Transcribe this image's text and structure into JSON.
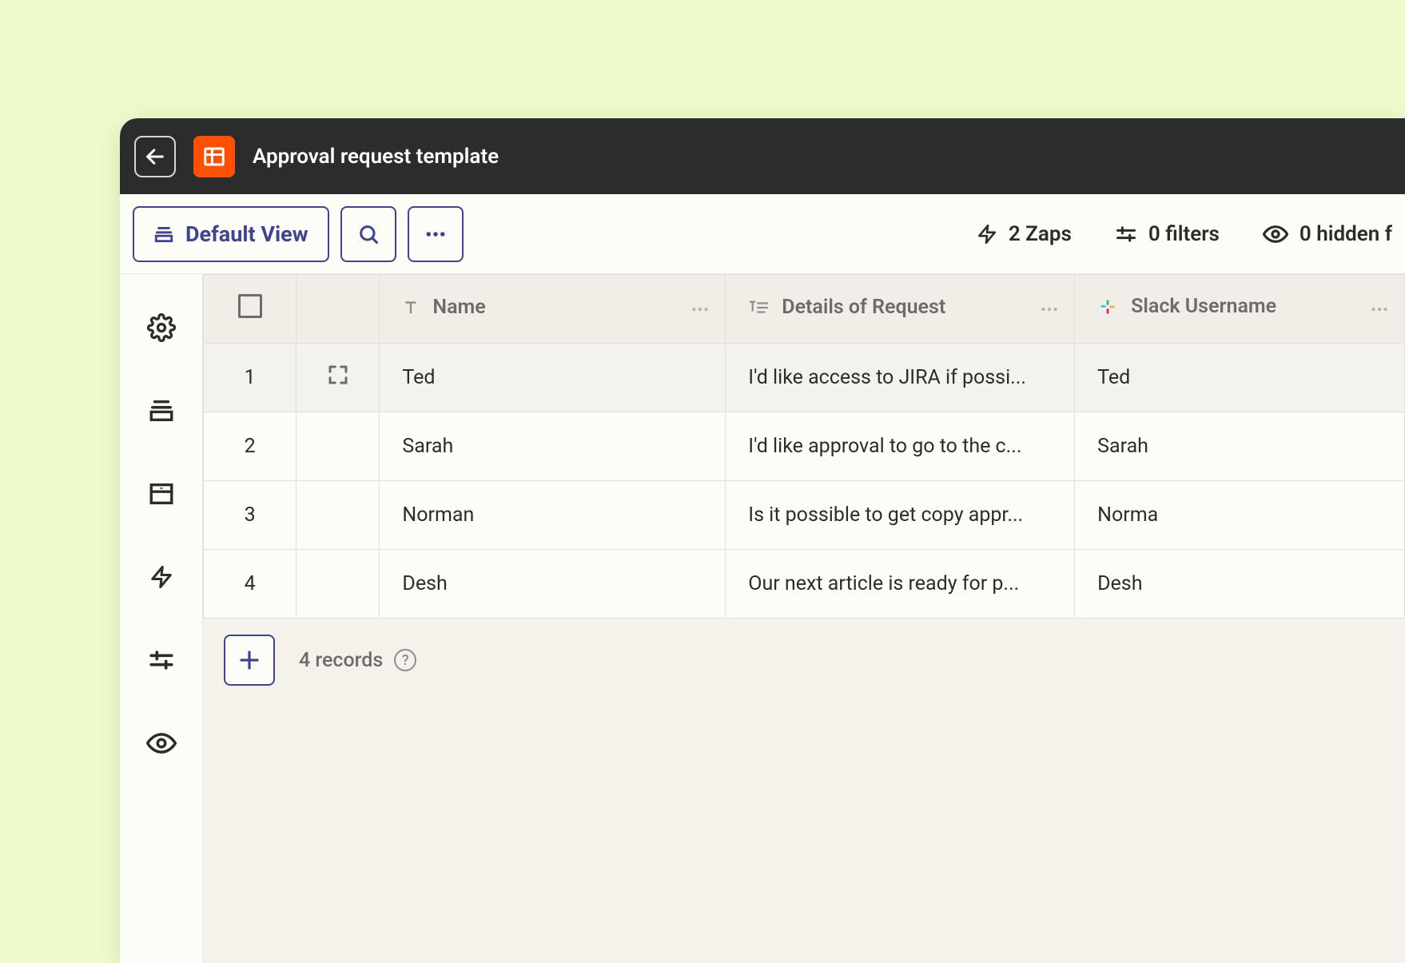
{
  "header": {
    "title": "Approval request template"
  },
  "toolbar": {
    "view_label": "Default View",
    "zaps_label": "2 Zaps",
    "filters_label": "0 filters",
    "hidden_label": "0 hidden f"
  },
  "columns": {
    "name": "Name",
    "details": "Details of Request",
    "slack": "Slack Username"
  },
  "rows": [
    {
      "num": "1",
      "name": "Ted",
      "details": "I'd like access to JIRA if possi...",
      "slack": "Ted"
    },
    {
      "num": "2",
      "name": "Sarah",
      "details": "I'd like approval to go to the c...",
      "slack": "Sarah"
    },
    {
      "num": "3",
      "name": "Norman",
      "details": "Is it possible to get copy appr...",
      "slack": "Norma"
    },
    {
      "num": "4",
      "name": "Desh",
      "details": "Our next article is ready for p...",
      "slack": "Desh"
    }
  ],
  "footer": {
    "records_label": "4 records"
  }
}
